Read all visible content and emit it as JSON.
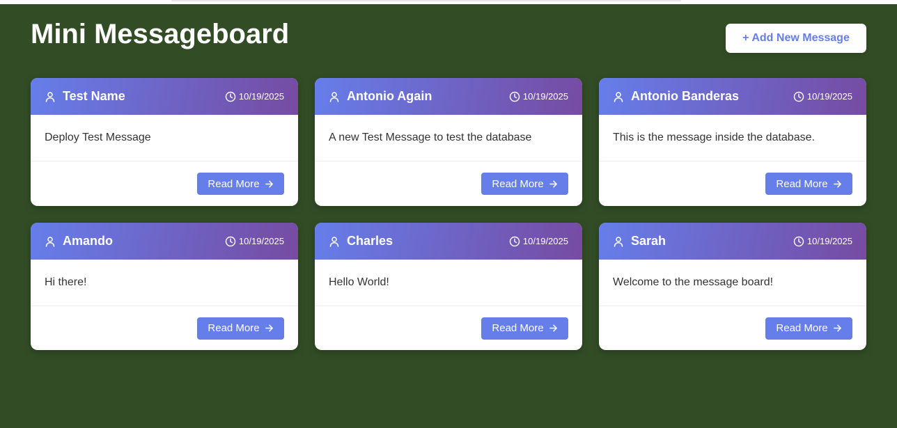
{
  "app": {
    "title": "Mini Messageboard",
    "add_button_label": "+ Add New Message"
  },
  "colors": {
    "background": "#324d26",
    "accent": "#667eea",
    "gradient_end": "#764ba2"
  },
  "icons": {
    "author": "user-icon",
    "date": "clock-icon",
    "read_more": "arrow-right-icon"
  },
  "messages": [
    {
      "author": "Test Name",
      "date": "10/19/2025",
      "text": "Deploy Test Message",
      "action": "Read More"
    },
    {
      "author": "Antonio Again",
      "date": "10/19/2025",
      "text": "A new Test Message to test the database",
      "action": "Read More"
    },
    {
      "author": "Antonio Banderas",
      "date": "10/19/2025",
      "text": "This is the message inside the database.",
      "action": "Read More"
    },
    {
      "author": "Amando",
      "date": "10/19/2025",
      "text": "Hi there!",
      "action": "Read More"
    },
    {
      "author": "Charles",
      "date": "10/19/2025",
      "text": "Hello World!",
      "action": "Read More"
    },
    {
      "author": "Sarah",
      "date": "10/19/2025",
      "text": "Welcome to the message board!",
      "action": "Read More"
    }
  ]
}
